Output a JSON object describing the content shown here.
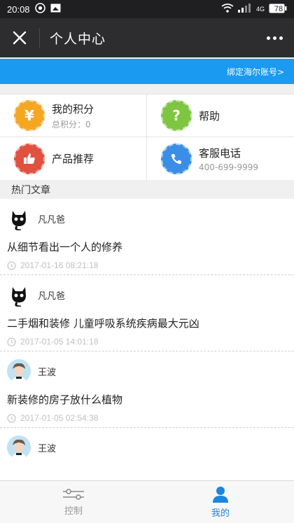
{
  "status_bar": {
    "time": "20:08",
    "signal_tag": "4G",
    "battery": "78"
  },
  "header": {
    "title": "个人中心"
  },
  "banner": {
    "link": "绑定海尔账号>"
  },
  "grid": [
    {
      "title": "我的积分",
      "sub_label": "总积分：",
      "sub_value": "0",
      "color": "#f5a623",
      "glyph": "¥"
    },
    {
      "title": "帮助",
      "color": "#7ec642",
      "glyph": "?"
    },
    {
      "title": "产品推荐",
      "color": "#e0513f"
    },
    {
      "title": "客服电话",
      "sub": "400-699-9999",
      "color": "#3a8ee6"
    }
  ],
  "section": {
    "title": "热门文章"
  },
  "articles": [
    {
      "author": "凡凡爸",
      "title": "从细节看出一个人的修养",
      "time": "2017-01-16 08:21:18",
      "avatar": "cat-avatar"
    },
    {
      "author": "凡凡爸",
      "title": "二手烟和装修 儿童呼吸系统疾病最大元凶",
      "time": "2017-01-05 14:01:18",
      "avatar": "cat-avatar"
    },
    {
      "author": "王波",
      "title": "新装修的房子放什么植物",
      "time": "2017-01-05 02:54:38",
      "avatar": "person-avatar"
    },
    {
      "author": "王波",
      "title": "",
      "time": "",
      "avatar": "person-avatar"
    }
  ],
  "bottom_nav": [
    {
      "label": "控制",
      "icon": "control-sliders-icon",
      "active": false
    },
    {
      "label": "我的",
      "icon": "user-icon",
      "active": true
    }
  ],
  "colors": {
    "accent": "#1a9af0",
    "titlebar": "#2d2d30",
    "statusbar": "#1f1f21"
  }
}
